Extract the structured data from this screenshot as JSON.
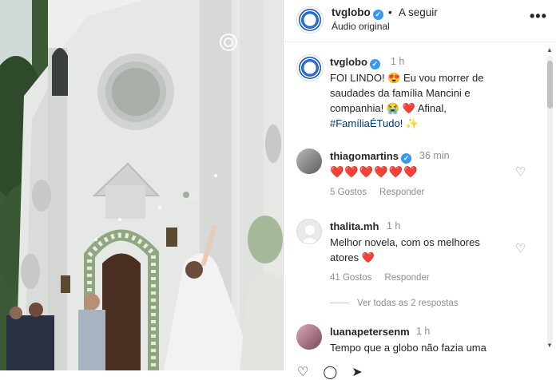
{
  "header": {
    "account_name": "tvglobo",
    "separator": "•",
    "follow_label": "A seguir",
    "audio_label": "Áudio original",
    "more_icon": "more-horizontal-icon"
  },
  "caption": {
    "account_name": "tvglobo",
    "time": "1 h",
    "line1": "FOI LINDO! 😍 Eu vou morrer de",
    "line2": "saudades da família Mancini e",
    "line3": "companhia! 😭 ❤️ Afinal,",
    "hashtag": "#FamíliaÉTudo!",
    "line4_emoji": " ✨"
  },
  "comments": [
    {
      "username": "thiagomartins",
      "verified": true,
      "time": "36 min",
      "text": "❤️❤️❤️❤️❤️❤️",
      "likes": "5 Gostos",
      "reply": "Responder"
    },
    {
      "username": "thalita.mh",
      "verified": false,
      "time": "1 h",
      "text_line1": "Melhor novela, com os melhores",
      "text_line2": "atores ❤️",
      "likes": "41 Gostos",
      "reply": "Responder",
      "view_replies": "Ver todas as 2 respostas"
    },
    {
      "username": "luanapetersenm",
      "verified": false,
      "time": "1 h",
      "text": "Tempo que a globo não fazia uma"
    }
  ],
  "colors": {
    "verified": "#3897f0",
    "heart": "#ed1c24",
    "secondary_text": "#8e8e8e",
    "hashtag": "#00376b"
  }
}
